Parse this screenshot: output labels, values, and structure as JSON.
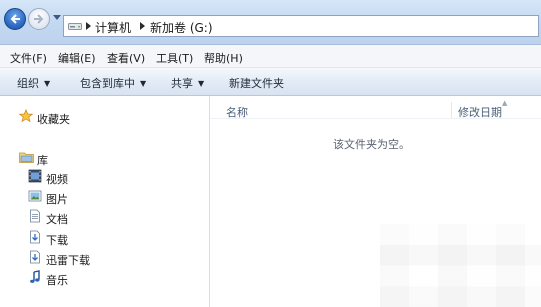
{
  "address_bar": {
    "breadcrumb": [
      "计算机",
      "新加卷 (G:)"
    ],
    "icons": {
      "back": "back-arrow-icon",
      "forward": "forward-arrow-icon",
      "recent": "chevron-down-icon",
      "drive": "drive-icon"
    }
  },
  "menu": {
    "items": [
      "文件(F)",
      "编辑(E)",
      "查看(V)",
      "工具(T)",
      "帮助(H)"
    ]
  },
  "commands": {
    "organize": "组织",
    "include_library": "包含到库中",
    "share": "共享",
    "new_folder": "新建文件夹"
  },
  "nav": {
    "favorites": "收藏夹",
    "libraries": "库",
    "library_items": [
      "视频",
      "图片",
      "文档",
      "下载",
      "迅雷下载",
      "音乐"
    ]
  },
  "content": {
    "columns": {
      "name": "名称",
      "date": "修改日期"
    },
    "empty_message": "该文件夹为空。"
  },
  "colors": {
    "address_bar_bg": "#c3d8f1",
    "back_button": "#2f6cc5",
    "header_text": "#4c607a"
  }
}
